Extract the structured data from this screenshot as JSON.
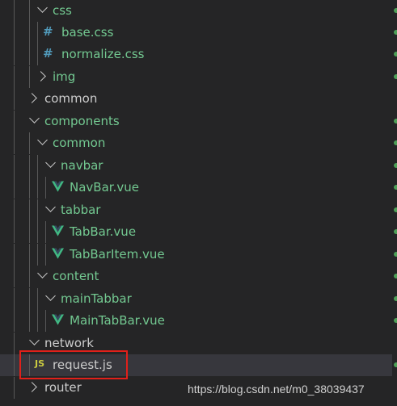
{
  "explorer": {
    "items": [
      {
        "label": "css"
      },
      {
        "label": "base.css"
      },
      {
        "label": "normalize.css"
      },
      {
        "label": "img"
      },
      {
        "label": "common"
      },
      {
        "label": "components"
      },
      {
        "label": "common"
      },
      {
        "label": "navbar"
      },
      {
        "label": "NavBar.vue"
      },
      {
        "label": "tabbar"
      },
      {
        "label": "TabBar.vue"
      },
      {
        "label": "TabBarItem.vue"
      },
      {
        "label": "content"
      },
      {
        "label": "mainTabbar"
      },
      {
        "label": "MainTabBar.vue"
      },
      {
        "label": "network"
      },
      {
        "label": "request.js"
      },
      {
        "label": "router"
      }
    ]
  },
  "icons": {
    "css_glyph": "#",
    "js_glyph": "JS",
    "css_color": "#519aba",
    "js_color": "#cbcb41",
    "vue_color": "#41b883"
  },
  "colors": {
    "modified_text": "#73c991",
    "highlight_box": "#e0201a"
  },
  "watermark": "https://blog.csdn.net/m0_38039437"
}
